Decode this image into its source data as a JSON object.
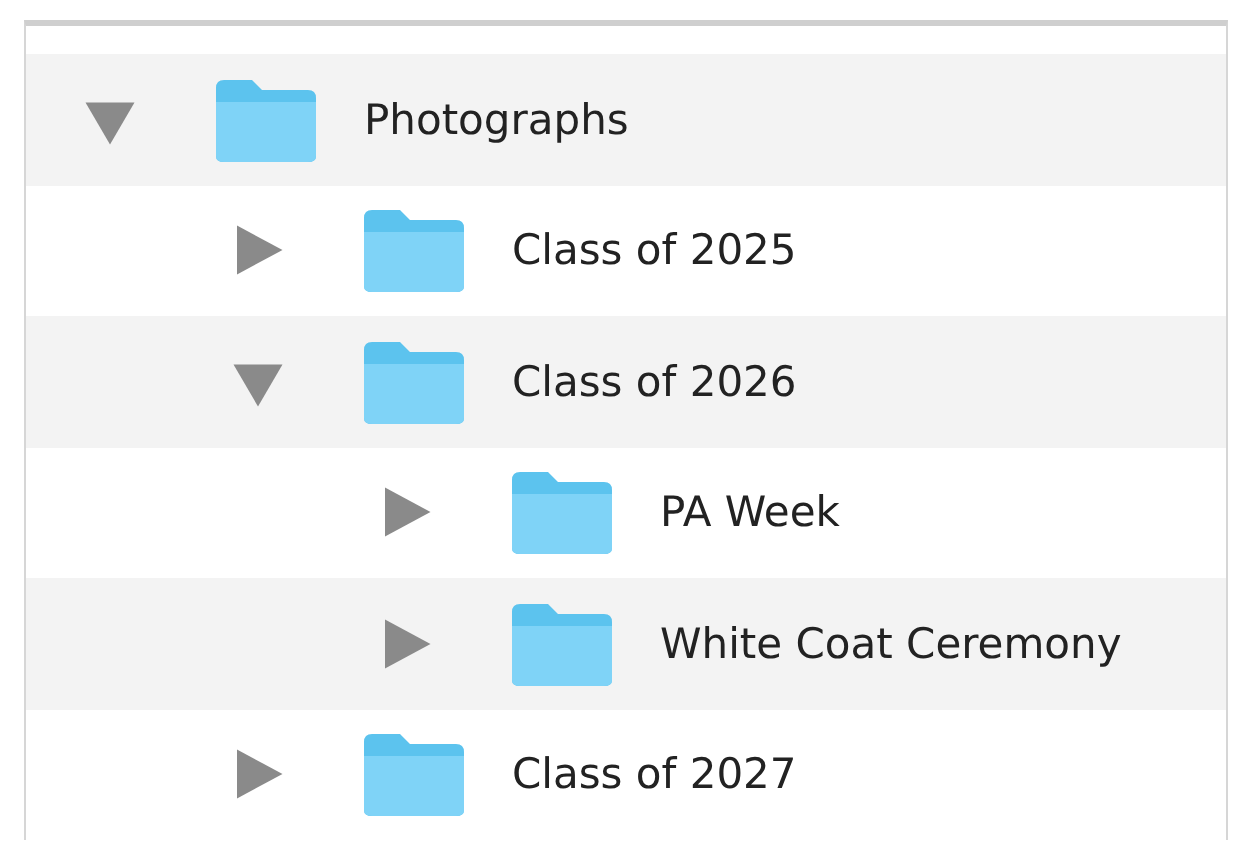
{
  "tree": [
    {
      "label": "Photographs",
      "expanded": true,
      "children": [
        {
          "label": "Class of 2025",
          "expanded": false
        },
        {
          "label": "Class of 2026",
          "expanded": true,
          "children": [
            {
              "label": "PA Week",
              "expanded": false
            },
            {
              "label": "White Coat Ceremony",
              "expanded": false
            }
          ]
        },
        {
          "label": "Class of 2027",
          "expanded": false
        }
      ]
    }
  ]
}
